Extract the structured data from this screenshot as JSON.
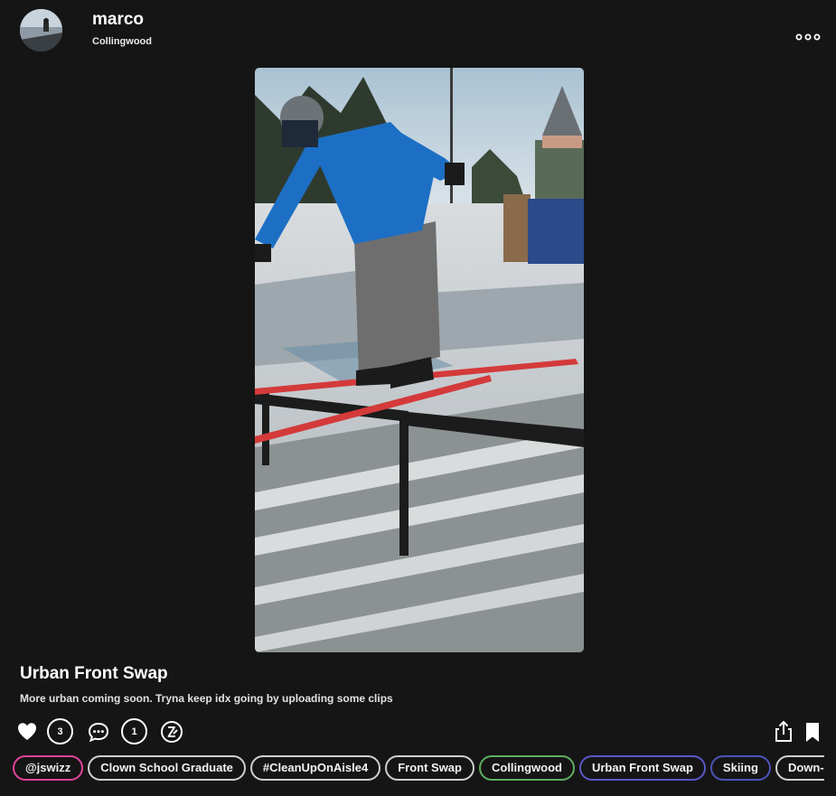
{
  "header": {
    "username": "marco",
    "location": "Collingwood"
  },
  "post": {
    "title": "Urban Front Swap",
    "description": "More urban coming soon. Tryna keep idx going by uploading some clips"
  },
  "actions": {
    "likes_count": "3",
    "comments_count": "1"
  },
  "tags": [
    {
      "label": "@jswizz",
      "color": "#e0439c"
    },
    {
      "label": "Clown School Graduate",
      "color": "#cfcfcf"
    },
    {
      "label": "#CleanUpOnAisle4",
      "color": "#cfcfcf"
    },
    {
      "label": "Front Swap",
      "color": "#cfcfcf"
    },
    {
      "label": "Collingwood",
      "color": "#5fae5f"
    },
    {
      "label": "Urban Front Swap",
      "color": "#5b57c8"
    },
    {
      "label": "Skiing",
      "color": "#4a54b8"
    },
    {
      "label": "Down-Flat",
      "color": "#cfcfcf"
    }
  ],
  "icons": {
    "more": "more-horizontal-icon",
    "like": "heart-icon",
    "comment": "comment-bubble-icon",
    "tag": "tag-badge-icon",
    "share": "share-icon",
    "bookmark": "bookmark-icon"
  }
}
